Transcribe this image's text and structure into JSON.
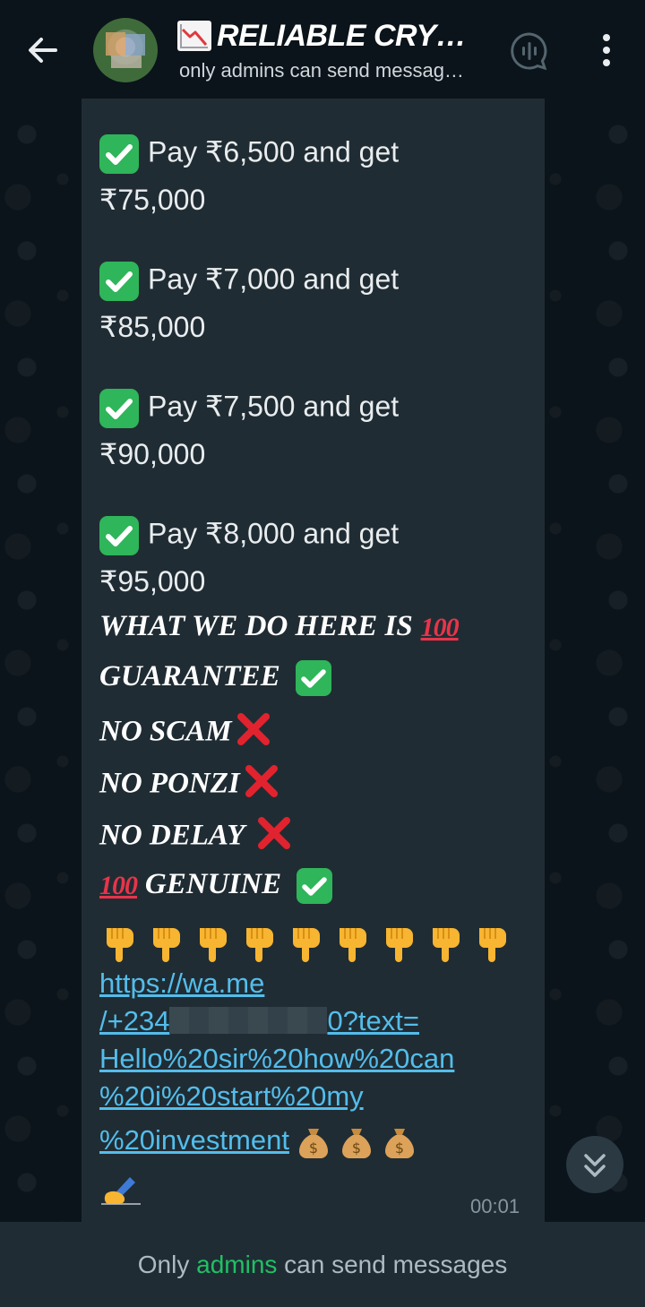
{
  "header": {
    "title": "RELIABLE CRY…",
    "subtitle": "only admins can send messag…",
    "icons": [
      "back-arrow-icon",
      "group-avatar",
      "chart-decreasing-icon",
      "voice-chat-icon",
      "more-vert-icon"
    ]
  },
  "message": {
    "offers": [
      {
        "pay": "Pay ₹6,500 and get",
        "get": "₹75,000"
      },
      {
        "pay": "Pay ₹7,000 and get",
        "get": "₹85,000"
      },
      {
        "pay": "Pay ₹7,500 and get",
        "get": "₹90,000"
      },
      {
        "pay": "Pay ₹8,000 and get",
        "get": "₹95,000"
      }
    ],
    "claims": {
      "what_we_do": "WHAT WE DO HERE IS",
      "guarantee": "GUARANTEE",
      "no_scam": "NO SCAM",
      "no_ponzi": "NO PONZI",
      "no_delay": "NO DELAY",
      "genuine": "GENUINE",
      "hundred": "100"
    },
    "link": {
      "line1": "https://wa.me",
      "line2_start": "/+234",
      "line2_end": "0?text=",
      "line3": "Hello%20sir%20how%20can",
      "line4": "%20i%20start%20my",
      "line5": "%20investment"
    },
    "time": "00:01",
    "emoji_icons": [
      "check-mark-icon",
      "cross-mark-icon",
      "hundred-points-icon",
      "pointing-down-icon",
      "money-bag-icon",
      "writing-hand-icon"
    ]
  },
  "footer": {
    "text_before": "Only ",
    "text_highlight": "admins",
    "text_after": " can send messages",
    "colors": {
      "highlight": "#21c063",
      "link": "#53bdeb",
      "bubble": "#202c33",
      "background": "#0b141a"
    }
  }
}
